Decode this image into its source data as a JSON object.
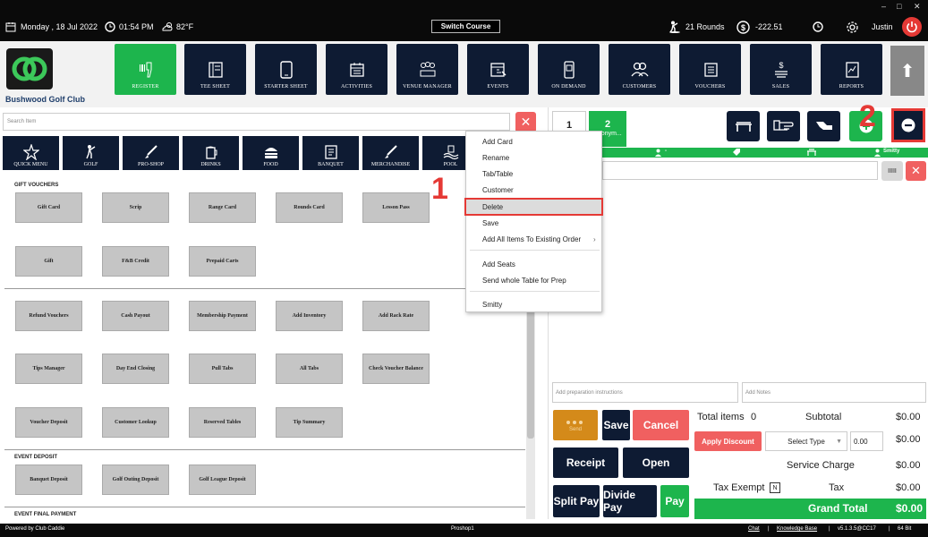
{
  "topbar": {
    "date": "Monday ,  18 Jul 2022",
    "time": "01:54 PM",
    "temperature": "82°F",
    "switch_course": "Switch Course",
    "rounds": "21 Rounds",
    "balance": "-222.51",
    "user": "Justin",
    "window_controls": [
      "–",
      "□",
      "✕"
    ]
  },
  "header": {
    "club_name": "Bushwood Golf Club",
    "nav": [
      "REGISTER",
      "TEE SHEET",
      "STARTER SHEET",
      "ACTIVITIES",
      "VENUE MANAGER",
      "EVENTS",
      "ON DEMAND",
      "CUSTOMERS",
      "VOUCHERS",
      "SALES",
      "REPORTS"
    ],
    "up_arrow": "⬆"
  },
  "search": {
    "placeholder": "Search Item",
    "clear": "✕"
  },
  "categories": [
    "QUICK MENU",
    "GOLF",
    "PRO-SHOP",
    "DRINKS",
    "FOOD",
    "BANQUET",
    "MERCHANDISE",
    "POOL"
  ],
  "sections": {
    "gift_vouchers": "GIFT VOUCHERS",
    "event_deposit": "EVENT DEPOSIT",
    "event_final_payment": "EVENT FINAL PAYMENT"
  },
  "tiles": {
    "row1": [
      "Gift Card",
      "Scrip",
      "Range Card",
      "Rounds Card",
      "Lesson Pass"
    ],
    "row2": [
      "Gift",
      "F&B Credit",
      "Prepaid Carts"
    ],
    "row3": [
      "Refund Vouchers",
      "Cash Payout",
      "Membership Payment",
      "Add Inventory",
      "Add Rack Rate"
    ],
    "row4": [
      "Tips Manager",
      "Day End Closing",
      "Pull Tabs",
      "All Tabs",
      "Check Voucher Balance"
    ],
    "row5": [
      "Voucher Deposit",
      "Customer Lookup",
      "Reserved Tables",
      "Tip Summary"
    ],
    "row6": [
      "Banquet Deposit",
      "Golf Outing Deposit",
      "Golf League Deposit"
    ]
  },
  "context_menu": {
    "items": [
      "Add Card",
      "Rename",
      "Tab/Table",
      "Customer",
      "Delete",
      "Save",
      "Add All Items To Existing Order",
      "Add Seats",
      "Send whole Table for Prep",
      "Smitty"
    ],
    "submenu_arrow": "›"
  },
  "annotations": {
    "one": "1",
    "two": "2"
  },
  "order": {
    "tab1": "1",
    "tab2": "2",
    "tab2_sub": "Anonym...",
    "strip_seat": "-",
    "strip_customer": "Smitty",
    "barcode": "IIIII",
    "clear": "✕",
    "prep_placeholder": "Add preparation instructions",
    "notes_placeholder": "Add Notes"
  },
  "actions": {
    "send": "Send",
    "save": "Save",
    "cancel": "Cancel",
    "receipt": "Receipt",
    "open": "Open",
    "split_pay": "Split Pay",
    "divide_pay": "Divide Pay",
    "pay": "Pay"
  },
  "totals": {
    "total_items_label": "Total items",
    "total_items": "0",
    "subtotal_label": "Subtotal",
    "subtotal": "$0.00",
    "apply_discount": "Apply Discount",
    "select_type": "Select Type",
    "discount_value": "0.00",
    "discount": "$0.00",
    "service_charge_label": "Service Charge",
    "service_charge": "$0.00",
    "tax_exempt_label": "Tax Exempt",
    "tax_exempt_box": "N",
    "tax_label": "Tax",
    "tax": "$0.00",
    "grand_total_label": "Grand Total",
    "grand_total": "$0.00"
  },
  "footer": {
    "powered_by": "Powered by Club Caddie",
    "station": "Proshop1",
    "chat": "Chat",
    "knowledge_base": "Knowledge Base",
    "version": "v5.1.3.5@CC17",
    "bits": "64 Bit"
  },
  "colors": {
    "navy": "#0e1b33",
    "green": "#1db54d",
    "red": "#f06060",
    "highlight": "#e53935"
  }
}
